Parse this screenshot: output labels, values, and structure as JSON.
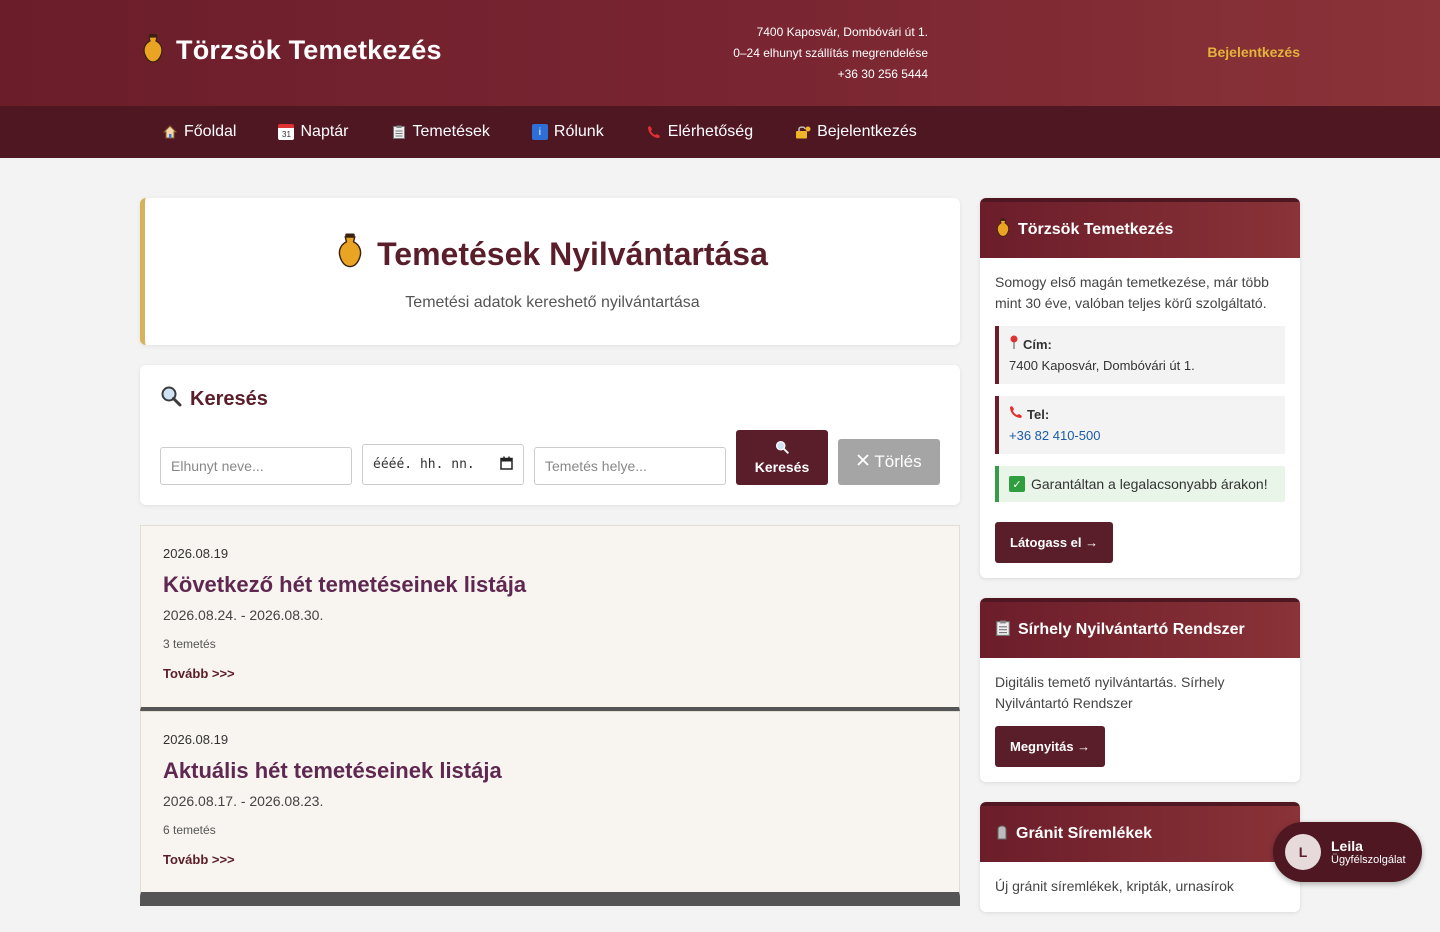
{
  "header": {
    "brand": "Törzsök Temetkezés",
    "contact_lines": [
      "7400 Kaposvár, Dombóvári út 1.",
      "0–24 elhunyt szállítás megrendelése",
      "+36 30 256 5444"
    ],
    "login_link": "Bejelentkezés",
    "accent_color": "#e3b33b"
  },
  "nav": {
    "items": [
      {
        "label": "Főoldal",
        "icon": "home-icon"
      },
      {
        "label": "Naptár",
        "icon": "calendar-icon",
        "icon_text": "31"
      },
      {
        "label": "Temetések",
        "icon": "clipboard-icon"
      },
      {
        "label": "Rólunk",
        "icon": "info-icon",
        "icon_text": "i"
      },
      {
        "label": "Elérhetőség",
        "icon": "phone-icon"
      },
      {
        "label": "Bejelentkezés",
        "icon": "lock-icon"
      }
    ]
  },
  "hero": {
    "title": "Temetések Nyilvántartása",
    "subtitle": "Temetési adatok kereshető nyilvántartása"
  },
  "search": {
    "heading": "Keresés",
    "name_placeholder": "Elhunyt neve...",
    "date_placeholder": "éééé. hh. nn.",
    "place_placeholder": "Temetés helye...",
    "search_button": "Keresés",
    "clear_button": "Törlés"
  },
  "posts": [
    {
      "date": "2026.08.19",
      "title": "Következő hét temetéseinek listája",
      "range": "2026.08.24. - 2026.08.30.",
      "count": "3 temetés",
      "more": "Tovább >>>"
    },
    {
      "date": "2026.08.19",
      "title": "Aktuális hét temetéseinek listája",
      "range": "2026.08.17. - 2026.08.23.",
      "count": "6 temetés",
      "more": "Tovább >>>"
    }
  ],
  "sidebar": {
    "company": {
      "title": "Törzsök Temetkezés",
      "text": "Somogy első magán temetkezése, már több mint 30 éve, valóban teljes körű szolgáltató.",
      "address_label": "Cím:",
      "address": "7400 Kaposvár, Dombóvári út 1.",
      "phone_label": "Tel:",
      "phone": "+36 82 410-500",
      "guarantee": "Garantáltan a legalacsonyabb árakon!",
      "button": "Látogass el →"
    },
    "registry": {
      "title": "Sírhely Nyilvántartó Rendszer",
      "text": "Digitális temető nyilvántartás. Sírhely Nyilvántartó Rendszer",
      "button": "Megnyitás →"
    },
    "granite": {
      "title": "Gránit Síremlékek",
      "text": "Új gránit síremlékek, kripták, urnasírok"
    }
  },
  "chat": {
    "initial": "L",
    "name": "Leila",
    "role": "Ügyfélszolgálat"
  }
}
